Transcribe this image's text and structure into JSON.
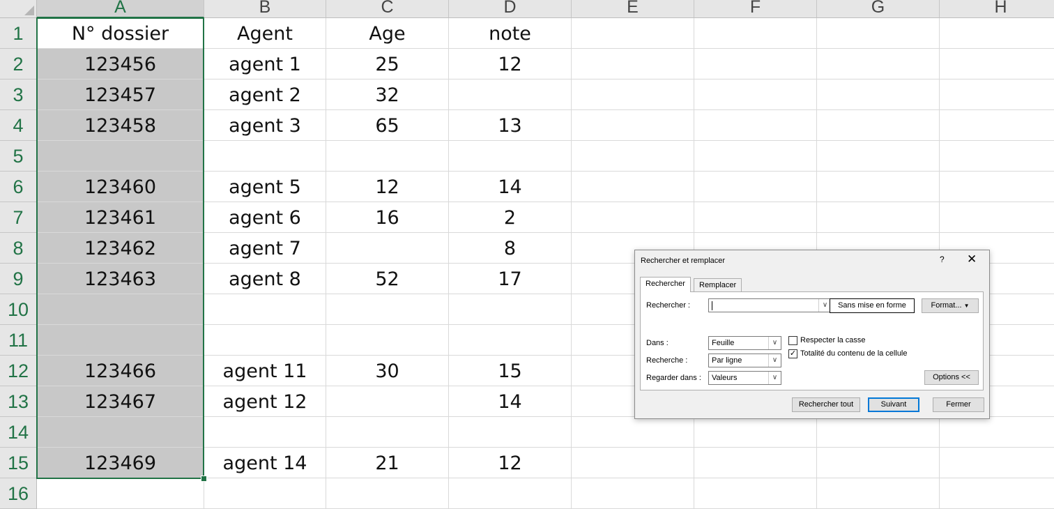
{
  "sheet": {
    "columns": [
      "A",
      "B",
      "C",
      "D",
      "E",
      "F",
      "G",
      "H"
    ],
    "rows": [
      {
        "num": "1",
        "cells": [
          "N° dossier",
          "Agent",
          "Age",
          "note",
          "",
          "",
          "",
          ""
        ]
      },
      {
        "num": "2",
        "cells": [
          "123456",
          "agent 1",
          "25",
          "12",
          "",
          "",
          "",
          ""
        ]
      },
      {
        "num": "3",
        "cells": [
          "123457",
          "agent 2",
          "32",
          "",
          "",
          "",
          "",
          ""
        ]
      },
      {
        "num": "4",
        "cells": [
          "123458",
          "agent 3",
          "65",
          "13",
          "",
          "",
          "",
          ""
        ]
      },
      {
        "num": "5",
        "cells": [
          "",
          "",
          "",
          "",
          "",
          "",
          "",
          ""
        ]
      },
      {
        "num": "6",
        "cells": [
          "123460",
          "agent 5",
          "12",
          "14",
          "",
          "",
          "",
          ""
        ]
      },
      {
        "num": "7",
        "cells": [
          "123461",
          "agent 6",
          "16",
          "2",
          "",
          "",
          "",
          ""
        ]
      },
      {
        "num": "8",
        "cells": [
          "123462",
          "agent 7",
          "",
          "8",
          "",
          "",
          "",
          ""
        ]
      },
      {
        "num": "9",
        "cells": [
          "123463",
          "agent 8",
          "52",
          "17",
          "",
          "",
          "",
          ""
        ]
      },
      {
        "num": "10",
        "cells": [
          "",
          "",
          "",
          "",
          "",
          "",
          "",
          ""
        ]
      },
      {
        "num": "11",
        "cells": [
          "",
          "",
          "",
          "",
          "",
          "",
          "",
          ""
        ]
      },
      {
        "num": "12",
        "cells": [
          "123466",
          "agent 11",
          "30",
          "15",
          "",
          "",
          "",
          ""
        ]
      },
      {
        "num": "13",
        "cells": [
          "123467",
          "agent 12",
          "",
          "14",
          "",
          "",
          "",
          ""
        ]
      },
      {
        "num": "14",
        "cells": [
          "",
          "",
          "",
          "",
          "",
          "",
          "",
          ""
        ]
      },
      {
        "num": "15",
        "cells": [
          "123469",
          "agent 14",
          "21",
          "12",
          "",
          "",
          "",
          ""
        ]
      },
      {
        "num": "16",
        "cells": [
          "",
          "",
          "",
          "",
          "",
          "",
          "",
          ""
        ]
      }
    ]
  },
  "dialog": {
    "title": "Rechercher et remplacer",
    "help": "?",
    "close": "✕",
    "tabs": [
      "Rechercher",
      "Remplacer"
    ],
    "find_label": "Rechercher :",
    "find_value": "",
    "no_format_button": "Sans mise en forme",
    "format_button": "Format...",
    "within_label": "Dans :",
    "within_value": "Feuille",
    "search_label": "Recherche :",
    "search_value": "Par ligne",
    "lookin_label": "Regarder dans :",
    "lookin_value": "Valeurs",
    "match_case_label": "Respecter la casse",
    "match_case_checked": false,
    "entire_cell_label": "Totalité du contenu de la cellule",
    "entire_cell_checked": true,
    "options_button": "Options <<",
    "find_all_button": "Rechercher tout",
    "find_next_button": "Suivant",
    "close_button": "Fermer"
  },
  "colors": {
    "accent": "#217346",
    "selection_fill": "#c8c8c8",
    "focus_blue": "#0078d7"
  }
}
